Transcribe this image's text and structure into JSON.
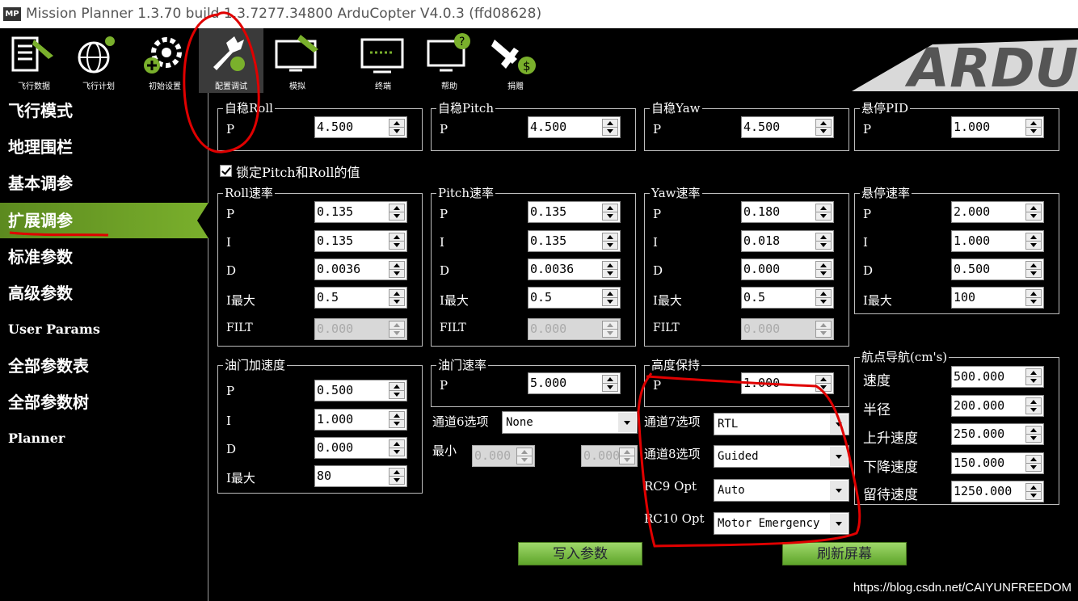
{
  "window": {
    "title": "Mission Planner 1.3.70 build 1.3.7277.34800 ArduCopter V4.0.3 (ffd08628)",
    "logo": "MP"
  },
  "toolbar": {
    "items": [
      {
        "label": "飞行数据",
        "icon": "flight-data-icon"
      },
      {
        "label": "飞行计划",
        "icon": "flight-plan-icon"
      },
      {
        "label": "初始设置",
        "icon": "initial-setup-icon"
      },
      {
        "label": "配置调试",
        "icon": "config-tuning-icon",
        "active": true
      },
      {
        "label": "模拟",
        "icon": "simulation-icon"
      },
      {
        "label": "终端",
        "icon": "terminal-icon"
      },
      {
        "label": "帮助",
        "icon": "help-icon"
      },
      {
        "label": "捐赠",
        "icon": "donate-icon"
      }
    ],
    "brand": "ARDU"
  },
  "sidebar": {
    "items": [
      {
        "label": "飞行模式"
      },
      {
        "label": "地理围栏"
      },
      {
        "label": "基本调参"
      },
      {
        "label": "扩展调参",
        "active": true
      },
      {
        "label": "标准参数"
      },
      {
        "label": "高级参数"
      },
      {
        "label": "User Params"
      },
      {
        "label": "全部参数表"
      },
      {
        "label": "全部参数树"
      },
      {
        "label": "Planner"
      }
    ]
  },
  "stab_roll": {
    "title": "自稳Roll",
    "p_label": "P",
    "p": "4.500"
  },
  "stab_pitch": {
    "title": "自稳Pitch",
    "p_label": "P",
    "p": "4.500"
  },
  "stab_yaw": {
    "title": "自稳Yaw",
    "p_label": "P",
    "p": "4.500"
  },
  "loiter_pid": {
    "title": "悬停PID",
    "p_label": "P",
    "p": "1.000"
  },
  "lock_pitch_roll": {
    "label": "锁定Pitch和Roll的值",
    "checked": true
  },
  "rate_roll": {
    "title": "Roll速率",
    "labels": [
      "P",
      "I",
      "D",
      "I最大",
      "FILT"
    ],
    "values": [
      "0.135",
      "0.135",
      "0.0036",
      "0.5",
      "0.000"
    ]
  },
  "rate_pitch": {
    "title": "Pitch速率",
    "labels": [
      "P",
      "I",
      "D",
      "I最大",
      "FILT"
    ],
    "values": [
      "0.135",
      "0.135",
      "0.0036",
      "0.5",
      "0.000"
    ]
  },
  "rate_yaw": {
    "title": "Yaw速率",
    "labels": [
      "P",
      "I",
      "D",
      "I最大",
      "FILT"
    ],
    "values": [
      "0.180",
      "0.018",
      "0.000",
      "0.5",
      "0.000"
    ]
  },
  "rate_loiter": {
    "title": "悬停速率",
    "labels": [
      "P",
      "I",
      "D",
      "I最大"
    ],
    "values": [
      "2.000",
      "1.000",
      "0.500",
      "100"
    ]
  },
  "throttle_accel": {
    "title": "油门加速度",
    "labels": [
      "P",
      "I",
      "D",
      "I最大"
    ],
    "values": [
      "0.500",
      "1.000",
      "0.000",
      "80"
    ]
  },
  "throttle_rate": {
    "title": "油门速率",
    "p_label": "P",
    "p": "5.000"
  },
  "alt_hold": {
    "title": "高度保持",
    "p_label": "P",
    "p": "1.000"
  },
  "ch6": {
    "label": "通道6选项",
    "value": "None",
    "min_label": "最小",
    "min": "0.000",
    "max": "0.000"
  },
  "ch7": {
    "label": "通道7选项",
    "value": "RTL"
  },
  "ch8": {
    "label": "通道8选项",
    "value": "Guided"
  },
  "rc9": {
    "label": "RC9 Opt",
    "value": "Auto"
  },
  "rc10": {
    "label": "RC10 Opt",
    "value": "Motor Emergency"
  },
  "wpnav": {
    "title": "航点导航(cm's)",
    "labels": [
      "速度",
      "半径",
      "上升速度",
      "下降速度",
      "留待速度"
    ],
    "values": [
      "500.000",
      "200.000",
      "250.000",
      "150.000",
      "1250.000"
    ]
  },
  "buttons": {
    "write": "写入参数",
    "refresh": "刷新屏幕"
  },
  "watermark": "https://blog.csdn.net/CAIYUNFREEDOM",
  "colors": {
    "accent": "#7ab02c",
    "annotation": "#e00000"
  }
}
